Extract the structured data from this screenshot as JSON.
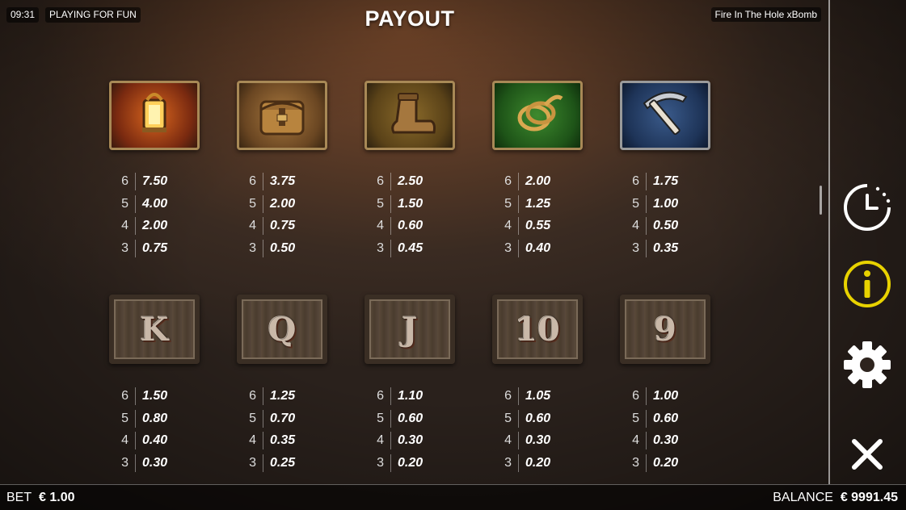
{
  "status": {
    "time": "09:31",
    "mode": "PLAYING FOR FUN",
    "game_name": "Fire In The Hole xBomb"
  },
  "title": "PAYOUT",
  "premium_symbols": [
    {
      "name": "lantern",
      "payouts": [
        {
          "count": "6",
          "value": "7.50"
        },
        {
          "count": "5",
          "value": "4.00"
        },
        {
          "count": "4",
          "value": "2.00"
        },
        {
          "count": "3",
          "value": "0.75"
        }
      ]
    },
    {
      "name": "bag",
      "payouts": [
        {
          "count": "6",
          "value": "3.75"
        },
        {
          "count": "5",
          "value": "2.00"
        },
        {
          "count": "4",
          "value": "0.75"
        },
        {
          "count": "3",
          "value": "0.50"
        }
      ]
    },
    {
      "name": "boot",
      "payouts": [
        {
          "count": "6",
          "value": "2.50"
        },
        {
          "count": "5",
          "value": "1.50"
        },
        {
          "count": "4",
          "value": "0.60"
        },
        {
          "count": "3",
          "value": "0.45"
        }
      ]
    },
    {
      "name": "rope",
      "payouts": [
        {
          "count": "6",
          "value": "2.00"
        },
        {
          "count": "5",
          "value": "1.25"
        },
        {
          "count": "4",
          "value": "0.55"
        },
        {
          "count": "3",
          "value": "0.40"
        }
      ]
    },
    {
      "name": "pickaxe",
      "payouts": [
        {
          "count": "6",
          "value": "1.75"
        },
        {
          "count": "5",
          "value": "1.00"
        },
        {
          "count": "4",
          "value": "0.50"
        },
        {
          "count": "3",
          "value": "0.35"
        }
      ]
    }
  ],
  "card_symbols": [
    {
      "letter": "K",
      "payouts": [
        {
          "count": "6",
          "value": "1.50"
        },
        {
          "count": "5",
          "value": "0.80"
        },
        {
          "count": "4",
          "value": "0.40"
        },
        {
          "count": "3",
          "value": "0.30"
        }
      ]
    },
    {
      "letter": "Q",
      "payouts": [
        {
          "count": "6",
          "value": "1.25"
        },
        {
          "count": "5",
          "value": "0.70"
        },
        {
          "count": "4",
          "value": "0.35"
        },
        {
          "count": "3",
          "value": "0.25"
        }
      ]
    },
    {
      "letter": "J",
      "payouts": [
        {
          "count": "6",
          "value": "1.10"
        },
        {
          "count": "5",
          "value": "0.60"
        },
        {
          "count": "4",
          "value": "0.30"
        },
        {
          "count": "3",
          "value": "0.20"
        }
      ]
    },
    {
      "letter": "10",
      "payouts": [
        {
          "count": "6",
          "value": "1.05"
        },
        {
          "count": "5",
          "value": "0.60"
        },
        {
          "count": "4",
          "value": "0.30"
        },
        {
          "count": "3",
          "value": "0.20"
        }
      ]
    },
    {
      "letter": "9",
      "payouts": [
        {
          "count": "6",
          "value": "1.00"
        },
        {
          "count": "5",
          "value": "0.60"
        },
        {
          "count": "4",
          "value": "0.30"
        },
        {
          "count": "3",
          "value": "0.20"
        }
      ]
    }
  ],
  "side_menu": {
    "history_icon": "clock-icon",
    "info_icon": "info-icon",
    "settings_icon": "gear-icon",
    "close_icon": "close-icon",
    "info_color": "#e8d200"
  },
  "footer": {
    "bet_label": "BET",
    "bet_value": "€ 1.00",
    "balance_label": "BALANCE",
    "balance_value": "€ 9991.45"
  }
}
